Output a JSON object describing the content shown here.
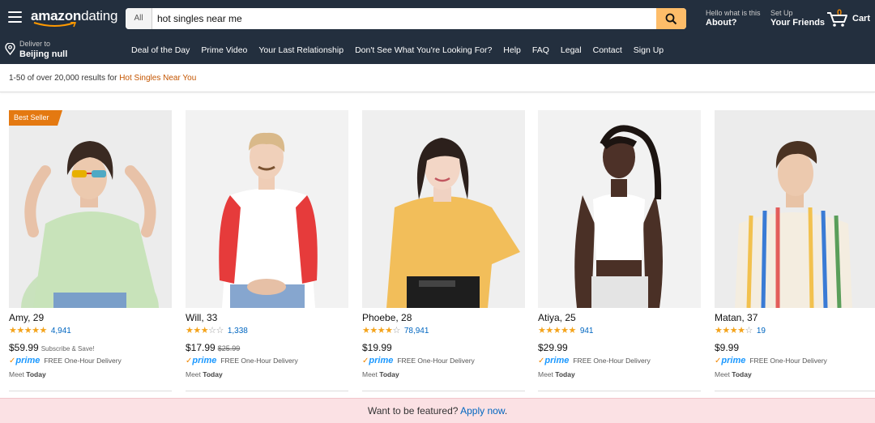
{
  "header": {
    "logo_brand": "amazon",
    "logo_sub": "dating",
    "search_category": "All",
    "search_value": "hot singles near me",
    "account_small": "Hello what is this",
    "account_big": "About?",
    "setup_small": "Set Up",
    "setup_big": "Your Friends",
    "cart_count": "0",
    "cart_label": "Cart"
  },
  "nav": {
    "deliver_small": "Deliver to",
    "deliver_big": "Beijing null",
    "links": [
      "Deal of the Day",
      "Prime Video",
      "Your Last Relationship",
      "Don't See What You're Looking For?",
      "Help",
      "FAQ",
      "Legal",
      "Contact",
      "Sign Up"
    ]
  },
  "results": {
    "prefix": "1-50 of over 20,000 results for ",
    "query": "Hot Singles Near You"
  },
  "products": [
    {
      "name": "Amy, 29",
      "stars": 4.5,
      "stars_text": "★★★★★",
      "reviews": "4,941",
      "price": "$59.99",
      "was": "",
      "promo": "Subscribe & Save!",
      "badge": "Best Seller",
      "prime": "prime",
      "shipping": "FREE One-Hour Delivery",
      "meet_prefix": "Meet ",
      "meet_day": "Today"
    },
    {
      "name": "Will, 33",
      "stars": 3,
      "stars_text": "★★★☆☆",
      "reviews": "1,338",
      "price": "$17.99",
      "was": "$25.99",
      "promo": "",
      "badge": "",
      "prime": "prime",
      "shipping": "FREE One-Hour Delivery",
      "meet_prefix": "Meet ",
      "meet_day": "Today"
    },
    {
      "name": "Phoebe, 28",
      "stars": 4,
      "stars_text": "★★★★☆",
      "reviews": "78,941",
      "price": "$19.99",
      "was": "",
      "promo": "",
      "badge": "",
      "prime": "prime",
      "shipping": "FREE One-Hour Delivery",
      "meet_prefix": "Meet ",
      "meet_day": "Today"
    },
    {
      "name": "Atiya, 25",
      "stars": 4.5,
      "stars_text": "★★★★★",
      "reviews": "941",
      "price": "$29.99",
      "was": "",
      "promo": "",
      "badge": "",
      "prime": "prime",
      "shipping": "FREE One-Hour Delivery",
      "meet_prefix": "Meet ",
      "meet_day": "Today"
    },
    {
      "name": "Matan, 37",
      "stars": 4,
      "stars_text": "★★★★☆",
      "reviews": "19",
      "price": "$9.99",
      "was": "",
      "promo": "",
      "badge": "",
      "prime": "prime",
      "shipping": "FREE One-Hour Delivery",
      "meet_prefix": "Meet ",
      "meet_day": "Today"
    }
  ],
  "banner": {
    "text": "Want to be featured? ",
    "link": "Apply now",
    "suffix": "."
  },
  "colors": {
    "header_bg": "#232f3e",
    "search_button": "#febd69",
    "star": "#f4a41d",
    "link": "#0066c0",
    "query": "#c45500",
    "badge": "#e47911",
    "banner_bg": "#fbe1e4"
  }
}
